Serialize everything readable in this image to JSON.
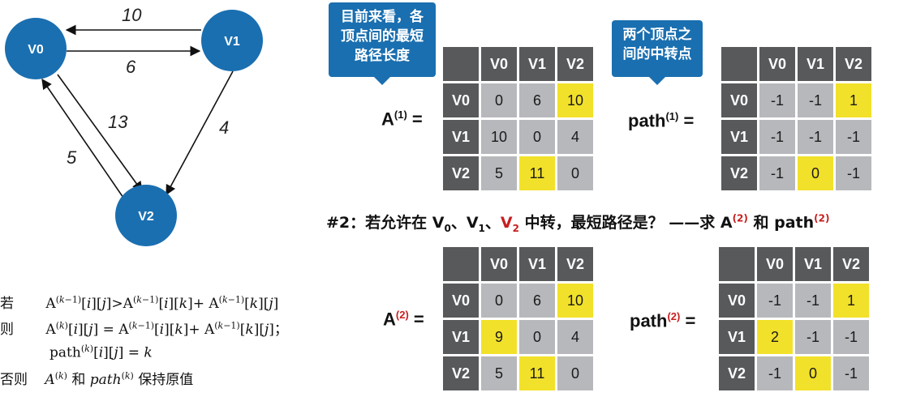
{
  "graph": {
    "nodes": [
      "V0",
      "V1",
      "V2"
    ],
    "edges": [
      {
        "from": "V1",
        "to": "V0",
        "weight": "10"
      },
      {
        "from": "V0",
        "to": "V1",
        "weight": "6"
      },
      {
        "from": "V0",
        "to": "V2",
        "weight": "13"
      },
      {
        "from": "V1",
        "to": "V2",
        "weight": "4"
      },
      {
        "from": "V2",
        "to": "V0",
        "weight": "5"
      }
    ]
  },
  "callouts": {
    "a_note": [
      "目前来看，各",
      "顶点间的最短",
      "路径长度"
    ],
    "path_note": [
      "两个顶点之",
      "间的中转点"
    ]
  },
  "labels": {
    "A": "A",
    "path": "path",
    "sup1": "(1)",
    "sup2": "(2)",
    "equals": "="
  },
  "headers": [
    "V0",
    "V1",
    "V2"
  ],
  "matrices": {
    "A1": [
      [
        "0",
        "6",
        "10"
      ],
      [
        "10",
        "0",
        "4"
      ],
      [
        "5",
        "11",
        "0"
      ]
    ],
    "path1": [
      [
        "-1",
        "-1",
        "1"
      ],
      [
        "-1",
        "-1",
        "-1"
      ],
      [
        "-1",
        "0",
        "-1"
      ]
    ],
    "A2": [
      [
        "0",
        "6",
        "10"
      ],
      [
        "9",
        "0",
        "4"
      ],
      [
        "5",
        "11",
        "0"
      ]
    ],
    "path2": [
      [
        "-1",
        "-1",
        "1"
      ],
      [
        "2",
        "-1",
        "-1"
      ],
      [
        "-1",
        "0",
        "-1"
      ]
    ]
  },
  "highlights": {
    "A1": [
      [
        0,
        2
      ],
      [
        2,
        1
      ]
    ],
    "path1": [
      [
        0,
        2
      ],
      [
        2,
        1
      ]
    ],
    "A2": [
      [
        0,
        2
      ],
      [
        1,
        0
      ],
      [
        2,
        1
      ]
    ],
    "path2": [
      [
        0,
        2
      ],
      [
        1,
        0
      ],
      [
        2,
        1
      ]
    ]
  },
  "step2": {
    "prefix": "#2：若允许在 V",
    "sub0": "0",
    "sep1": "、V",
    "sub1": "1",
    "sep2": "、",
    "v2": "V",
    "sub2": "2",
    "mid": " 中转，最短路径是？ ——求 A",
    "sup_a": "(2)",
    "and": " 和 path",
    "sup_p": "(2)"
  },
  "rules": {
    "r1_cond": "若",
    "r2_then": "则",
    "r4_else": "否则",
    "r4_tail": "保持原值",
    "r4_and": "和"
  },
  "colors": {
    "node_fill": "#1a6fb0",
    "header_bg": "#58595b",
    "cell_bg": "#b7b8bc",
    "highlight": "#f2e12a",
    "red": "#c81e1e"
  }
}
